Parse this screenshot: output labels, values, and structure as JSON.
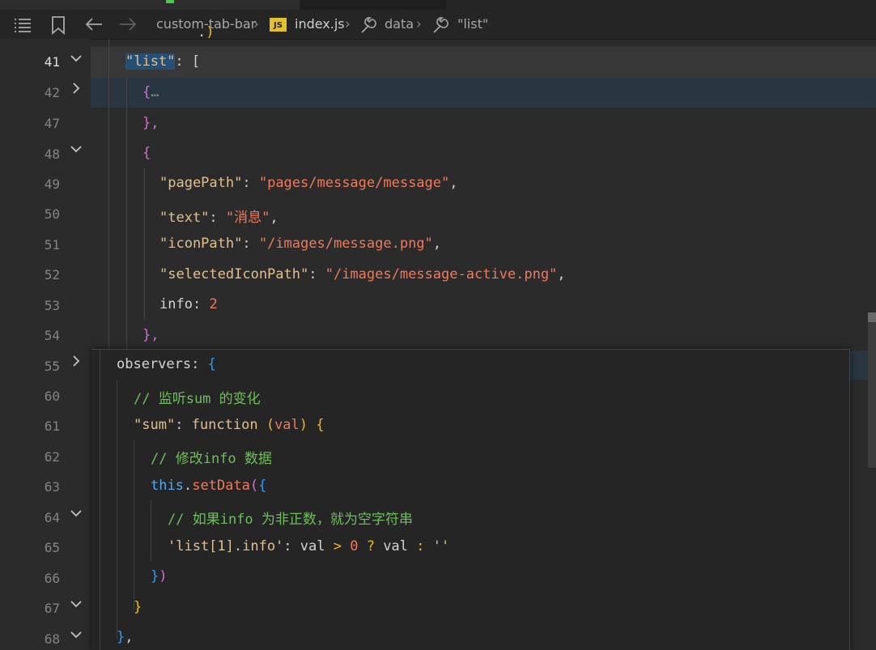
{
  "breadcrumb": {
    "items": [
      "custom-tab-bar",
      "index.js",
      "data",
      "\"list\""
    ],
    "js_badge": "JS"
  },
  "gutter": {
    "lines": [
      "41",
      "42",
      "47",
      "48",
      "49",
      "50",
      "51",
      "52",
      "53",
      "54",
      "55",
      "60",
      "61",
      "62",
      "63",
      "64",
      "65",
      "66",
      "67",
      "68"
    ],
    "active_line": "41"
  },
  "code": {
    "l41_key": "\"list\"",
    "l41_rest": ": [",
    "l42": "{",
    "l42_ellipsis": "…",
    "l47": "},",
    "l48": "{",
    "l49_key": "\"pagePath\"",
    "l49_val": "\"pages/message/message\"",
    "l50_key": "\"text\"",
    "l50_val": "\"消息\"",
    "l51_key": "\"iconPath\"",
    "l51_val": "\"/images/message.png\"",
    "l52_key": "\"selectedIconPath\"",
    "l52_val": "\"/images/message-active.png\"",
    "l53_key": "info",
    "l53_val": "2",
    "l54": "},"
  },
  "popup": {
    "p1_key": "observers",
    "p2_comment": "// 监听sum 的变化",
    "p3_key": "\"sum\"",
    "p3_fn": "function",
    "p3_arg": "val",
    "p4_comment": "// 修改info 数据",
    "p5_this": "this",
    "p5_method": "setData",
    "p6_comment": "// 如果info 为非正数，就为空字符串",
    "p7_key": "'list[1].info'",
    "p7_ident": "val",
    "p7_num": "0",
    "p7_empty": "''",
    "p8": "})",
    "p9": "}",
    "p10": "},"
  }
}
